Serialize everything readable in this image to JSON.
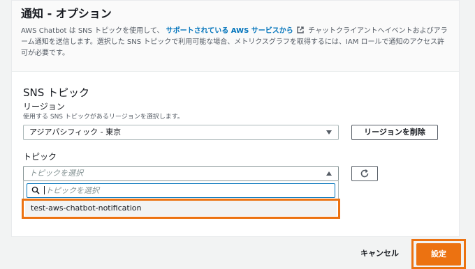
{
  "header": {
    "title": "通知 - オプション",
    "desc_part1": "AWS Chatbot は SNS トピックを使用して、",
    "desc_link": "サポートされている AWS サービスから",
    "desc_part2": "チャットクライアントへイベントおよびアラーム通知を送信します。選択した SNS トピックで利用可能な場合、メトリクスグラフを取得するには、IAM ロールで通知のアクセス許可が必要です。",
    "link_icon": "external-link-icon"
  },
  "sns": {
    "section_title": "SNS トピック",
    "region_label": "リージョン",
    "region_hint": "使用する SNS トピックがあるリージョンを選択します。",
    "region_value": "アジアパシフィック - 東京",
    "remove_region_button": "リージョンを削除",
    "topic_label": "トピック",
    "topic_placeholder": "トピックを選択",
    "filter_placeholder": "トピックを選択",
    "options": [
      "test-aws-chatbot-notification"
    ],
    "refresh_icon": "refresh-icon",
    "search_icon": "search-icon"
  },
  "footer": {
    "cancel_label": "キャンセル",
    "submit_label": "設定"
  },
  "colors": {
    "accent": "#ec7211",
    "link": "#0073bb"
  }
}
